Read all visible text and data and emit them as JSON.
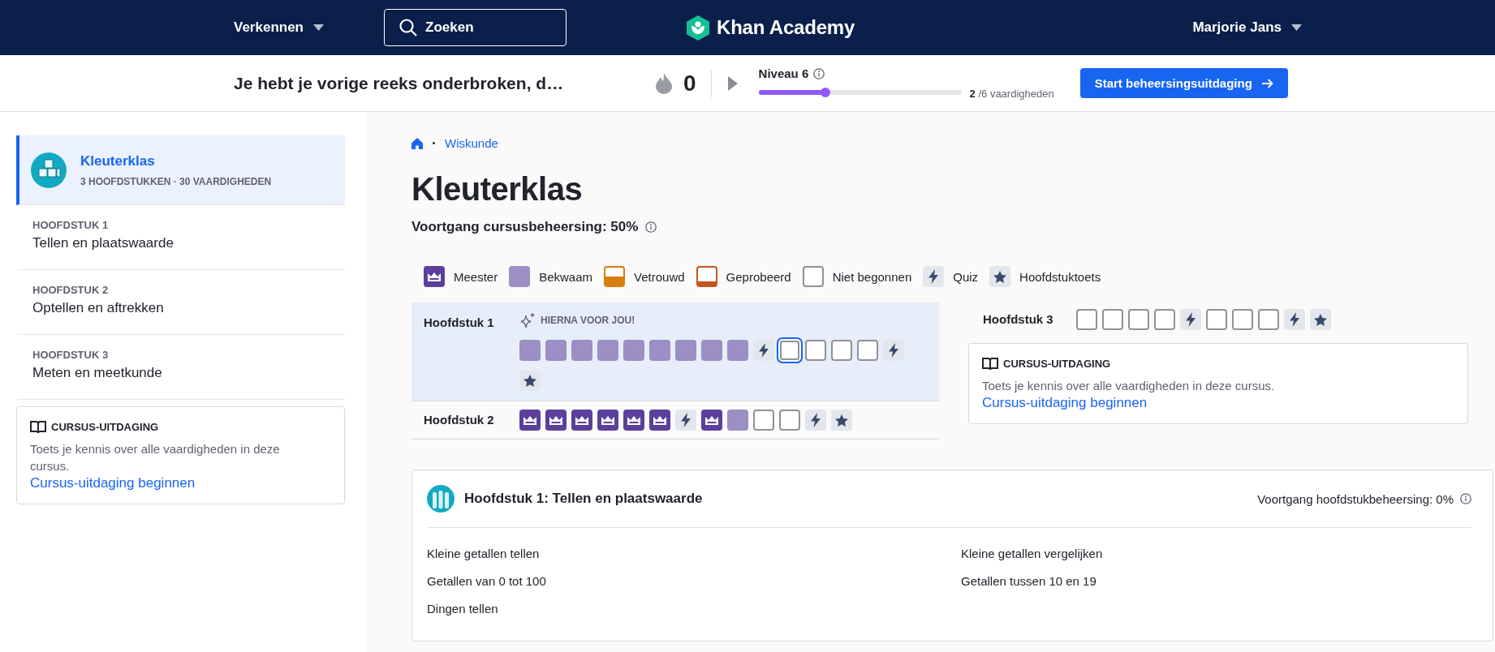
{
  "nav": {
    "explore": "Verkennen",
    "search": "Zoeken",
    "logo": "Khan Academy",
    "user": "Marjorie Jans"
  },
  "streak_bar": {
    "message": "Je hebt je vorige reeks onderbroken, d…",
    "streak": "0",
    "level_label": "Niveau 6",
    "level": 0.33,
    "progress": "**2** /6 vaardigheden",
    "button": "Start beheersingsuitdaging"
  },
  "sidebar": {
    "items": [
      {
        "kind": "course",
        "title": "Kleuterklas",
        "subtitle": "3 HOOFDSTUKKEN · 30 VAARDIGHEDEN",
        "selected": true
      },
      {
        "kind": "unit",
        "label": "HOOFDSTUK 1",
        "title": "Tellen en plaatswaarde",
        "selected": false
      },
      {
        "kind": "unit",
        "label": "HOOFDSTUK 2",
        "title": "Optellen en aftrekken",
        "selected": false
      },
      {
        "kind": "unit",
        "label": "HOOFDSTUK 3",
        "title": "Meten en meetkunde",
        "selected": false
      }
    ],
    "challenge": {
      "heading": "CURSUS-UITDAGING",
      "text": "Toets je kennis over alle vaardigheden in deze cursus.",
      "link": "Cursus-uitdaging beginnen"
    }
  },
  "main": {
    "breadcrumb": "Wiskunde",
    "title": "Kleuterklas",
    "progress": "Voortgang cursusbeheersing: 50%",
    "legend": [
      {
        "kind": "mastered",
        "label": "Meester"
      },
      {
        "kind": "proficient",
        "label": "Bekwaam"
      },
      {
        "kind": "familiar",
        "label": "Vetrouwd"
      },
      {
        "kind": "attempted",
        "label": "Geprobeerd"
      },
      {
        "kind": "not_started",
        "label": "Niet begonnen"
      },
      {
        "kind": "quiz",
        "label": "Quiz"
      },
      {
        "kind": "unit_test",
        "label": "Hoofdstuktoets"
      }
    ],
    "chapters": [
      {
        "name": "Hoofdstuk 1",
        "selected": true,
        "note": "HIERNA VOOR JOU!",
        "skills": [
          {
            "kind": "proficient",
            "selected": false
          },
          {
            "kind": "proficient",
            "selected": false
          },
          {
            "kind": "proficient",
            "selected": false
          },
          {
            "kind": "proficient",
            "selected": false
          },
          {
            "kind": "proficient",
            "selected": false
          },
          {
            "kind": "proficient",
            "selected": false
          },
          {
            "kind": "proficient",
            "selected": false
          },
          {
            "kind": "proficient",
            "selected": false
          },
          {
            "kind": "proficient",
            "selected": false
          },
          {
            "kind": "quiz",
            "selected": false
          },
          {
            "kind": "not_started",
            "selected": true
          },
          {
            "kind": "not_started",
            "selected": false
          },
          {
            "kind": "not_started",
            "selected": false
          },
          {
            "kind": "not_started",
            "selected": false
          },
          {
            "kind": "quiz",
            "selected": false
          },
          {
            "kind": "unit_test",
            "selected": false
          }
        ]
      },
      {
        "name": "Hoofdstuk 2",
        "selected": false,
        "skills": [
          {
            "kind": "mastered",
            "selected": false
          },
          {
            "kind": "mastered",
            "selected": false
          },
          {
            "kind": "mastered",
            "selected": false
          },
          {
            "kind": "mastered",
            "selected": false
          },
          {
            "kind": "mastered",
            "selected": false
          },
          {
            "kind": "mastered",
            "selected": false
          },
          {
            "kind": "quiz",
            "selected": false
          },
          {
            "kind": "mastered",
            "selected": false
          },
          {
            "kind": "proficient",
            "selected": false
          },
          {
            "kind": "not_started",
            "selected": false
          },
          {
            "kind": "not_started",
            "selected": false
          },
          {
            "kind": "quiz",
            "selected": false
          },
          {
            "kind": "unit_test",
            "selected": false
          }
        ]
      },
      {
        "name": "Hoofdstuk 3",
        "selected": false,
        "skills": [
          {
            "kind": "not_started",
            "selected": false
          },
          {
            "kind": "not_started",
            "selected": false
          },
          {
            "kind": "not_started",
            "selected": false
          },
          {
            "kind": "not_started",
            "selected": false
          },
          {
            "kind": "quiz",
            "selected": false
          },
          {
            "kind": "not_started",
            "selected": false
          },
          {
            "kind": "not_started",
            "selected": false
          },
          {
            "kind": "not_started",
            "selected": false
          },
          {
            "kind": "quiz",
            "selected": false
          },
          {
            "kind": "unit_test",
            "selected": false
          }
        ]
      }
    ],
    "challenge": {
      "heading": "CURSUS-UITDAGING",
      "text": "Toets je kennis over alle vaardigheden in deze cursus.",
      "link": "Cursus-uitdaging beginnen"
    },
    "unit_card": {
      "title": "Hoofdstuk 1: Tellen en plaatswaarde",
      "progress": "Voortgang hoofdstukbeheersing: 0%",
      "skills": [
        "Kleine getallen tellen",
        "Getallen van 0 tot 100",
        "Dingen tellen",
        "Kleine getallen vergelijken",
        "Getallen tussen 10 en 19"
      ]
    }
  }
}
